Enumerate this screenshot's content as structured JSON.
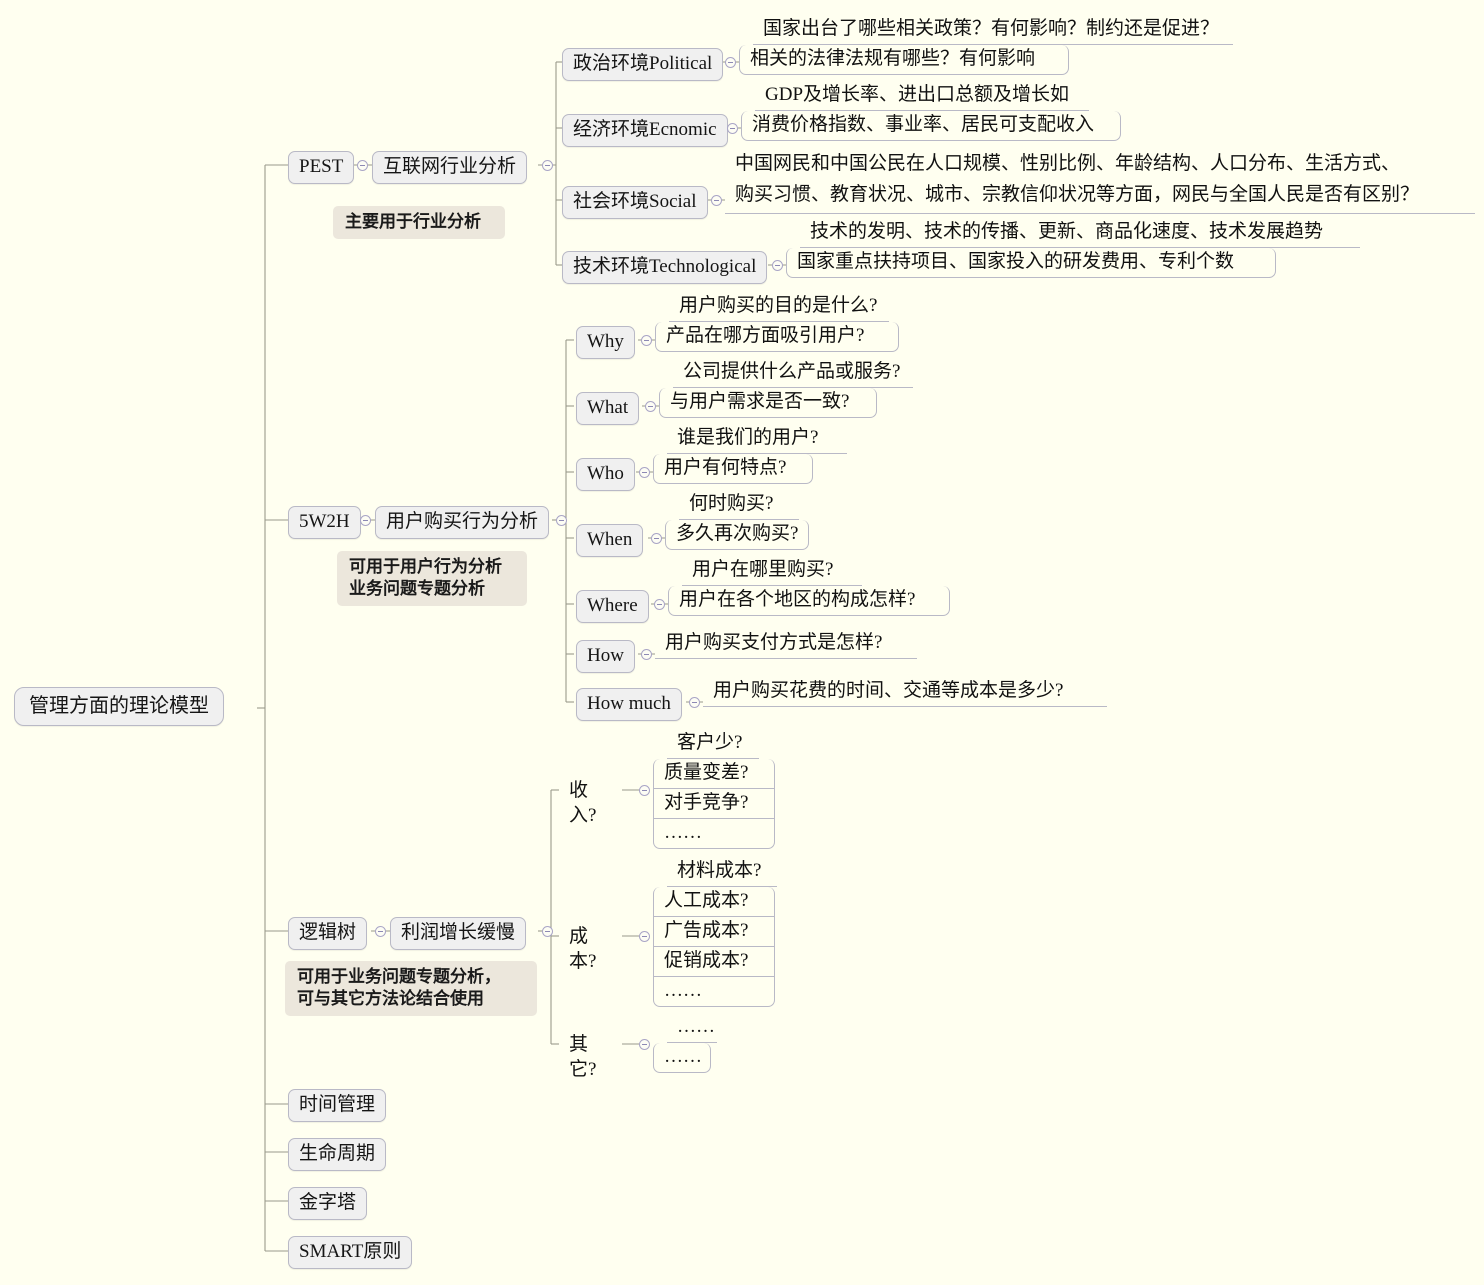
{
  "title": "管理方面的理论模型",
  "colors": {
    "background": "#fffff0",
    "node_fill": "#f0f0f0",
    "node_border": "#b9b9c6",
    "note_fill": "#ece7dc",
    "link": "#9a9a8c",
    "toggle": "#8d89b4"
  },
  "root": {
    "label": "管理方面的理论模型"
  },
  "branches": [
    {
      "id": "pest",
      "label": "PEST",
      "note": "主要用于行业分析",
      "child": {
        "label": "互联网行业分析"
      },
      "groups": [
        {
          "label": "政治环境Political",
          "leaves": [
            "国家出台了哪些相关政策？有何影响？制约还是促进？",
            "相关的法律法规有哪些？有何影响"
          ]
        },
        {
          "label": "经济环境Ecnomic",
          "leaves": [
            "GDP及增长率、进出口总额及增长如",
            "消费价格指数、事业率、居民可支配收入"
          ]
        },
        {
          "label": "社会环境Social",
          "leaves": [
            "中国网民和中国公民在人口规模、性别比例、年龄结构、人口分布、生活方式、\n购买习惯、教育状况、城市、宗教信仰状况等方面，网民与全国人民是否有区别？"
          ]
        },
        {
          "label": "技术环境Technological",
          "leaves": [
            "技术的发明、技术的传播、更新、商品化速度、技术发展趋势",
            "国家重点扶持项目、国家投入的研发费用、专利个数"
          ]
        }
      ]
    },
    {
      "id": "5w2h",
      "label": "5W2H",
      "note": "可用于用户行为分析\n业务问题专题分析",
      "child": {
        "label": "用户购买行为分析"
      },
      "groups": [
        {
          "label": "Why",
          "leaves": [
            "用户购买的目的是什么?",
            "产品在哪方面吸引用户?"
          ]
        },
        {
          "label": "What",
          "leaves": [
            "公司提供什么产品或服务?",
            "与用户需求是否一致?"
          ]
        },
        {
          "label": "Who",
          "leaves": [
            "谁是我们的用户?",
            "用户有何特点?"
          ]
        },
        {
          "label": "When",
          "leaves": [
            "何时购买?",
            "多久再次购买?"
          ]
        },
        {
          "label": "Where",
          "leaves": [
            "用户在哪里购买?",
            "用户在各个地区的构成怎样?"
          ]
        },
        {
          "label": "How",
          "leaves": [
            "用户购买支付方式是怎样?"
          ]
        },
        {
          "label": "How much",
          "leaves": [
            "用户购买花费的时间、交通等成本是多少?"
          ]
        }
      ]
    },
    {
      "id": "logictree",
      "label": "逻辑树",
      "note": "可用于业务问题专题分析，\n可与其它方法论结合使用",
      "child": {
        "label": "利润增长缓慢"
      },
      "groups": [
        {
          "label": "收入?",
          "leaves": [
            "客户少?",
            "质量变差?",
            "对手竞争?",
            "……"
          ]
        },
        {
          "label": "成本?",
          "leaves": [
            "材料成本?",
            "人工成本?",
            "广告成本?",
            "促销成本?",
            "……"
          ]
        },
        {
          "label": "其它?",
          "leaves": [
            "……",
            "……"
          ]
        }
      ]
    },
    {
      "id": "time",
      "label": "时间管理"
    },
    {
      "id": "lifecycle",
      "label": "生命周期"
    },
    {
      "id": "pyramid",
      "label": "金字塔"
    },
    {
      "id": "smart",
      "label": "SMART原则"
    }
  ]
}
